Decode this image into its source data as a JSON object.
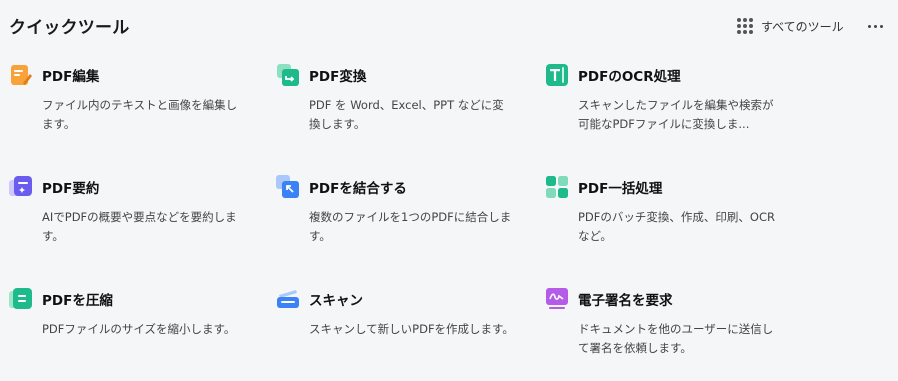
{
  "header": {
    "title": "クイックツール",
    "all_tools_label": "すべてのツール"
  },
  "tools": [
    {
      "name": "PDF編集",
      "desc": "ファイル内のテキストと画像を編集します。",
      "icon": "pdf-edit-icon"
    },
    {
      "name": "PDF変換",
      "desc": "PDF を Word、Excel、PPT などに変換します。",
      "icon": "pdf-convert-icon"
    },
    {
      "name": "PDFのOCR処理",
      "desc": "スキャンしたファイルを編集や検索が可能なPDFファイルに変換しま...",
      "icon": "ocr-icon"
    },
    {
      "name": "PDF要約",
      "desc": "AIでPDFの概要や要点などを要約します。",
      "icon": "ai-summary-icon"
    },
    {
      "name": "PDFを結合する",
      "desc": "複数のファイルを1つのPDFに結合します。",
      "icon": "merge-icon"
    },
    {
      "name": "PDF一括処理",
      "desc": "PDFのバッチ変換、作成、印刷、OCRなど。",
      "icon": "batch-icon"
    },
    {
      "name": "PDFを圧縮",
      "desc": "PDFファイルのサイズを縮小します。",
      "icon": "compress-icon"
    },
    {
      "name": "スキャン",
      "desc": "スキャンして新しいPDFを作成します。",
      "icon": "scan-icon"
    },
    {
      "name": "電子署名を要求",
      "desc": "ドキュメントを他のユーザーに送信して署名を依頼します。",
      "icon": "esign-icon"
    }
  ],
  "colors": {
    "background": "#f5f6f8",
    "orange": "#f5922a",
    "green": "#1fba8c",
    "purple": "#6b5cf0",
    "blue": "#3b82f6",
    "magenta": "#b45be8"
  }
}
